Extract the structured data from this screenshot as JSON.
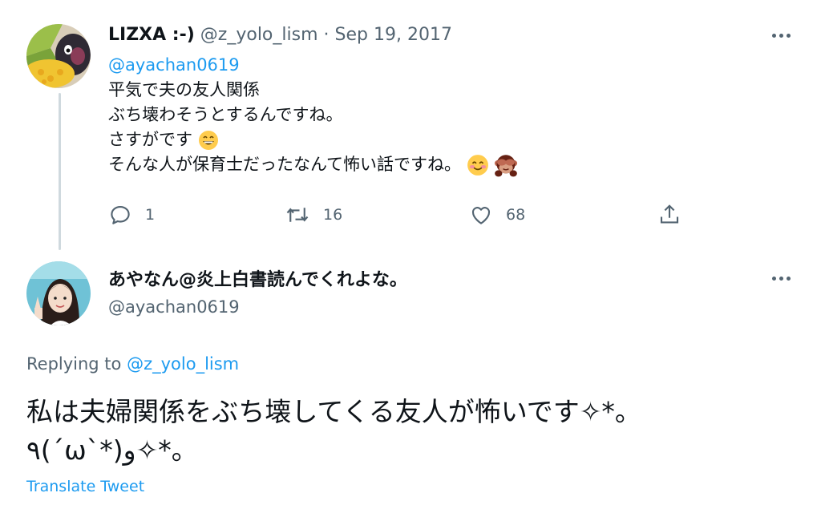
{
  "tweet1": {
    "display_name": "LIZXA :-)",
    "handle": "@z_yolo_lism",
    "separator": "·",
    "date": "Sep 19, 2017",
    "mention": "@ayachan0619",
    "lines": [
      "平気で夫の友人関係",
      "ぶち壊わそうとするんですね。",
      "さすがです",
      "そんな人が保育士だったなんて怖い話ですね。"
    ],
    "emojis": [
      "grinning-face-emoji",
      "smiling-face-emoji",
      "see-no-evil-monkey-emoji"
    ],
    "actions": {
      "reply_count": "1",
      "retweet_count": "16",
      "like_count": "68"
    }
  },
  "tweet2": {
    "display_name": "あやなん@炎上白書読んでくれよな。",
    "handle": "@ayachan0619",
    "replying_prefix": "Replying to",
    "replying_handle": "@z_yolo_lism",
    "text_line1": "私は夫婦関係をぶち壊してくる友人が怖いです✧*。",
    "text_line2": "٩(ˊωˋ*)و✧*。",
    "translate_label": "Translate Tweet"
  },
  "colors": {
    "accent": "#1d9bf0",
    "secondary_text": "#536471",
    "thread_line": "#cfd9de"
  },
  "icons": [
    "more-icon",
    "reply-icon",
    "retweet-icon",
    "like-icon",
    "share-icon"
  ]
}
